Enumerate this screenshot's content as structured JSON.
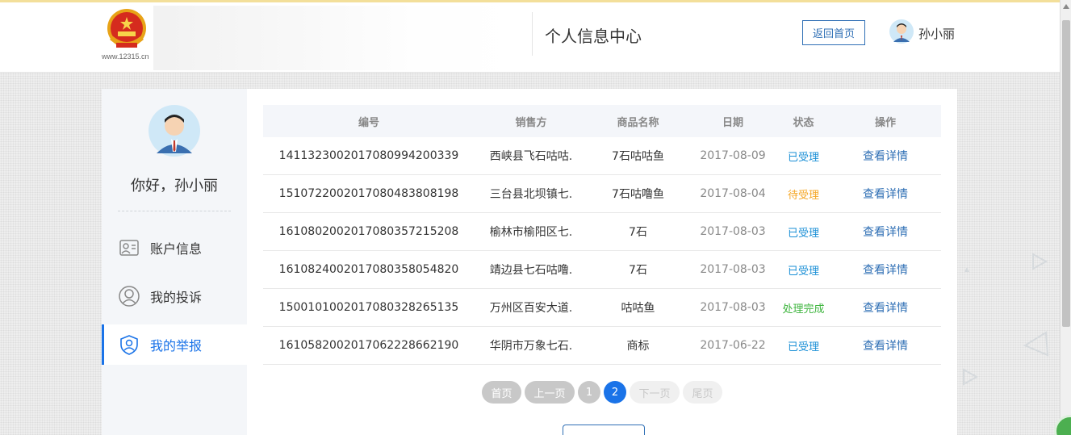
{
  "header": {
    "logo_url_text": "www.12315.cn",
    "title": "个人信息中心",
    "home_button": "返回首页",
    "user_name": "孙小丽"
  },
  "sidebar": {
    "greeting": "你好，孙小丽",
    "items": [
      {
        "label": "账户信息",
        "icon": "id-card-icon",
        "active": false
      },
      {
        "label": "我的投诉",
        "icon": "person-icon",
        "active": false
      },
      {
        "label": "我的举报",
        "icon": "shield-icon",
        "active": true
      }
    ]
  },
  "table": {
    "columns": [
      "编号",
      "销售方",
      "商品名称",
      "日期",
      "状态",
      "操作"
    ],
    "rows": [
      {
        "id": "141132300201708099420 0339",
        "seller": "西峡县飞石咕咕.",
        "product": "7石咕咕鱼",
        "date": "2017-08-09",
        "status": "已受理",
        "action": "查看详情"
      },
      {
        "id": "151072200201708048380 8198",
        "seller": "三台县北坝镇七.",
        "product": "7石咕噜鱼",
        "date": "2017-08-04",
        "status": "待受理",
        "action": "查看详情"
      },
      {
        "id": "161080200201708035721 5208",
        "seller": "榆林市榆阳区七.",
        "product": "7石",
        "date": "2017-08-03",
        "status": "已受理",
        "action": "查看详情"
      },
      {
        "id": "161082400201708035805 4820",
        "seller": "靖边县七石咕噜.",
        "product": "7石",
        "date": "2017-08-03",
        "status": "已受理",
        "action": "查看详情"
      },
      {
        "id": "150010100201708032826 5135",
        "seller": "万州区百安大道.",
        "product": "咕咕鱼",
        "date": "2017-08-03",
        "status": "处理完成",
        "action": "查看详情"
      },
      {
        "id": "161058200201706222866 2190",
        "seller": "华阴市万象七石.",
        "product": "商标",
        "date": "2017-06-22",
        "status": "已受理",
        "action": "查看详情"
      }
    ]
  },
  "status_colors": {
    "已受理": "#1a8fd6",
    "待受理": "#f5a623",
    "处理完成": "#3cb43c"
  },
  "pagination": {
    "first": "首页",
    "prev": "上一页",
    "pages": [
      "1",
      "2"
    ],
    "current": "2",
    "next": "下一页",
    "last": "尾页"
  },
  "colors": {
    "accent": "#1a73e8",
    "link": "#2f6fb5"
  }
}
